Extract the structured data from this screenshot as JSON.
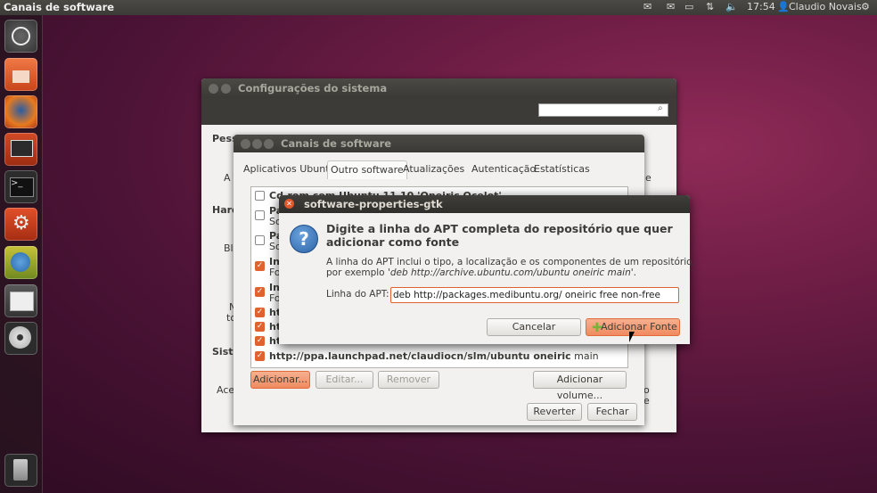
{
  "topbar": {
    "app_title": "Canais de software",
    "time": "17:54",
    "user": "Claudio Novais"
  },
  "launcher": {
    "items": [
      "dash-home",
      "files",
      "firefox",
      "presentation",
      "terminal",
      "system-settings",
      "update-manager",
      "workspace-switcher",
      "disc"
    ],
    "trash": "trash"
  },
  "settings_window": {
    "title": "Configurações do sistema",
    "search_placeholder": "",
    "left_labels": [
      "Pess",
      "Hard",
      "Sist"
    ],
    "fragments": {
      "a1": "A",
      "b1": "Bl",
      "n1": "N",
      "to": "to",
      "ace": "Ace",
      "e1": "e",
      "o1": "o",
      "e2": "e"
    }
  },
  "channels_window": {
    "title": "Canais de software",
    "tabs": [
      "Aplicativos Ubuntu",
      "Outro software",
      "Atualizações",
      "Autenticação",
      "Estatísticas"
    ],
    "active_tab": "Outro software",
    "rows": [
      {
        "text": "Cd-rom com Ubuntu 11.10 'Oneiric Ocelot'",
        "checked": false
      },
      {
        "text": "Pa",
        "sub": "So",
        "checked": false
      },
      {
        "text": "Pa",
        "sub": "So",
        "checked": false
      },
      {
        "text": "In",
        "sub": "Fo",
        "checked": true
      },
      {
        "text": "In",
        "sub": "Fo",
        "checked": true
      },
      {
        "text": "ht",
        "checked": true
      },
      {
        "text": "ht",
        "checked": true
      },
      {
        "text": "ht",
        "checked": true
      },
      {
        "text_bold": "http://ppa.launchpad.net/claudiocn/slm/ubuntu oneiric",
        "text_rest": "main",
        "checked": true
      }
    ],
    "buttons": {
      "add": "Adicionar...",
      "edit": "Editar...",
      "remove": "Remover",
      "add_volume": "Adicionar volume...",
      "revert": "Reverter",
      "close": "Fechar"
    }
  },
  "dialog": {
    "title": "software-properties-gtk",
    "heading": "Digite a linha do APT completa do repositório que quer adicionar como fonte",
    "desc_line1": "A linha do APT inclui o tipo, a localização e os componentes de um repositório,",
    "desc_line2_prefix": "por exemplo '",
    "desc_example": "deb http://archive.ubuntu.com/ubuntu oneiric main",
    "desc_line2_suffix": "'.",
    "field_label": "Linha do APT:",
    "field_value": "deb http://packages.medibuntu.org/ oneiric free non-free",
    "cancel": "Cancelar",
    "add_source": "Adicionar Fonte"
  },
  "colors": {
    "accent": "#e0622f",
    "panel": "#3c3b37",
    "window_bg": "#f2f1f0"
  }
}
